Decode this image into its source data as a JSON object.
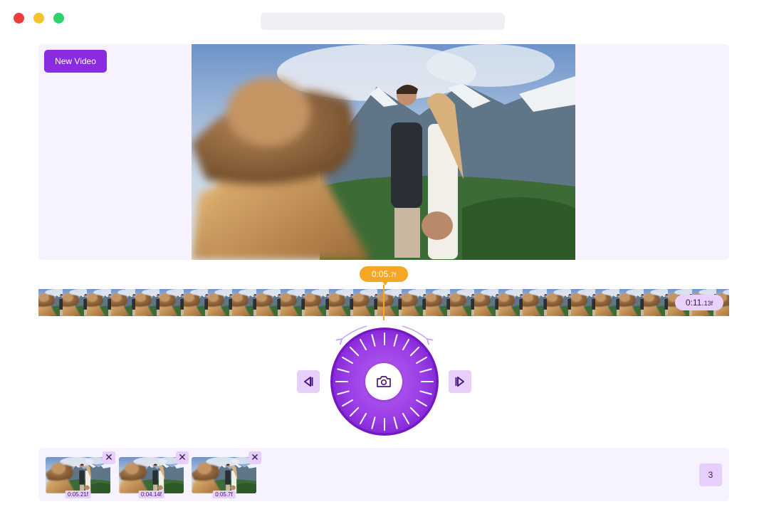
{
  "window": {
    "traffic_lights": {
      "close": "#f23b3b",
      "minimize": "#f5c32a",
      "zoom": "#2fd36b"
    }
  },
  "toolbar": {
    "new_video_label": "New Video"
  },
  "playhead": {
    "time": "0:05.",
    "frame": "7f"
  },
  "timeline": {
    "duration_time": "0:11.",
    "duration_frame": "13f",
    "frame_count": 30
  },
  "controls": {
    "prev_icon": "step-back-icon",
    "next_icon": "step-forward-icon",
    "capture_icon": "camera-icon"
  },
  "snapshots": [
    {
      "label": "0:05.21f"
    },
    {
      "label": "0:04.14f"
    },
    {
      "label": "0:05.7f"
    }
  ],
  "snapshot_count": "3",
  "colors": {
    "accent": "#8a2be2",
    "panel": "#f7f2ff",
    "playhead": "#f5a623",
    "chip": "#e7cffb"
  }
}
